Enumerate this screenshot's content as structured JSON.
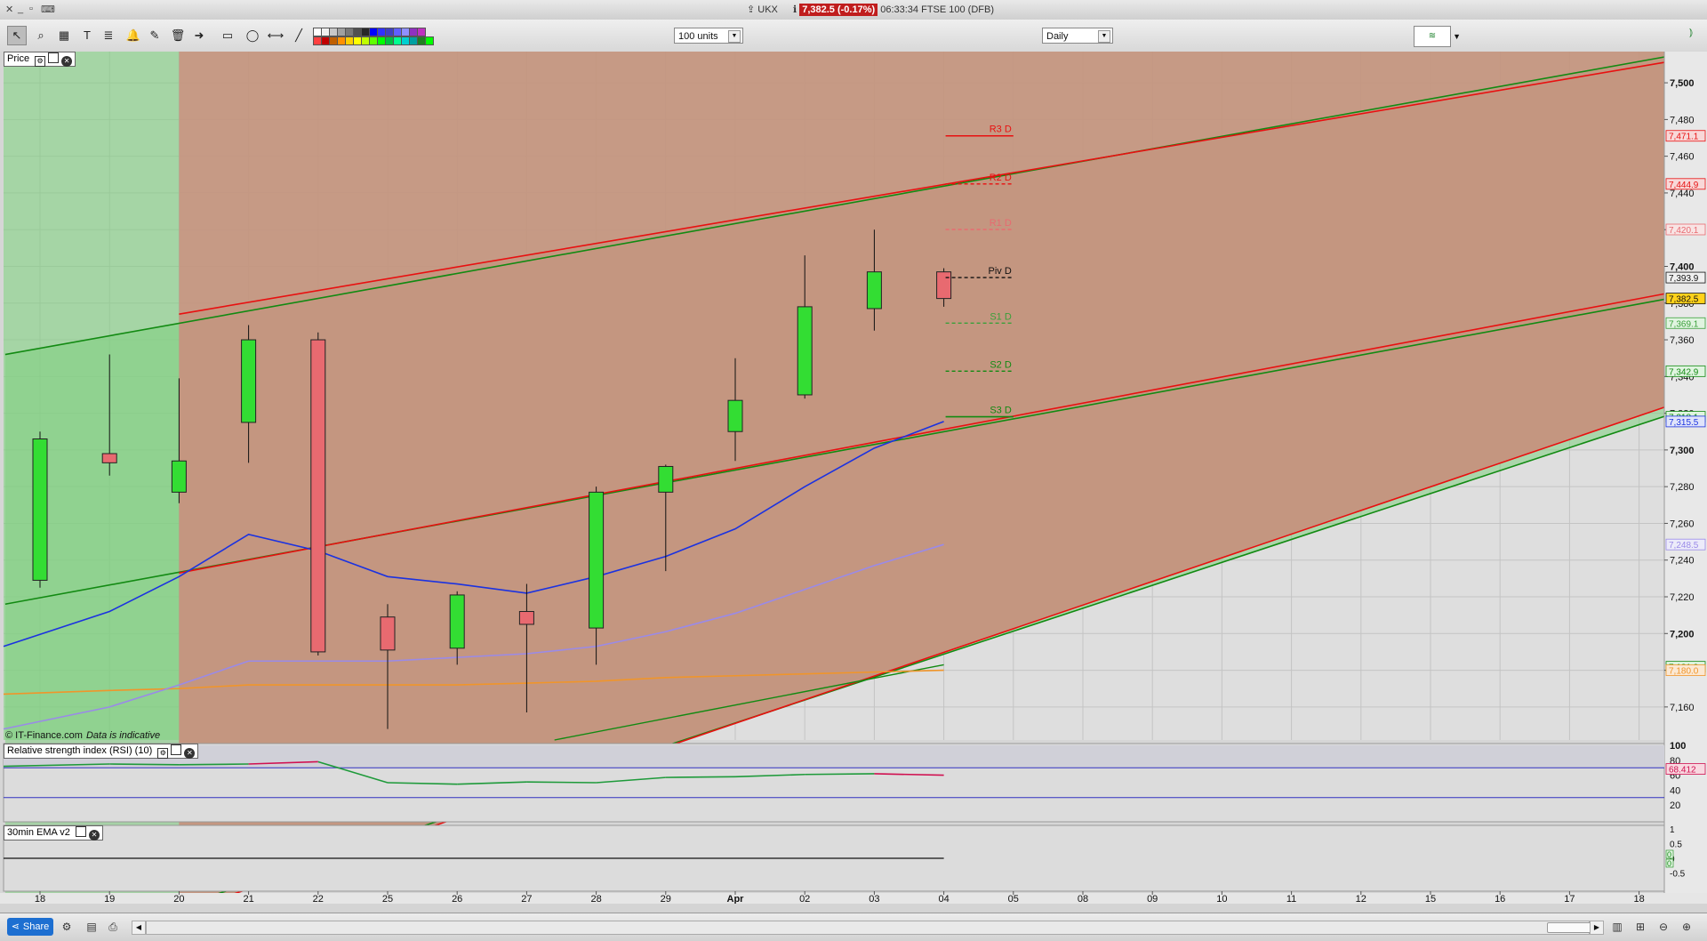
{
  "titlebar": {
    "symbol": "UKX",
    "price_badge": "7,382.5 (-0.17%)",
    "time_desc": "06:33:34 FTSE 100 (DFB)"
  },
  "toolbar": {
    "units_select": "100 units",
    "period_select": "Daily",
    "swatch_colors_row1": [
      "#ffffff",
      "#f0f0f0",
      "#c8c8c8",
      "#a0a0a0",
      "#787878",
      "#505050",
      "#282828",
      "#0000ff",
      "#3030ff",
      "#4040c0",
      "#6060ff",
      "#9090ff",
      "#9030c0",
      "#c030c0"
    ],
    "swatch_colors_row2": [
      "#ff4040",
      "#c00000",
      "#c06000",
      "#ff9000",
      "#ffd000",
      "#ffff00",
      "#c0ff00",
      "#60ff00",
      "#00ff00",
      "#00c040",
      "#00ff90",
      "#00d0d0",
      "#00a0a0",
      "#208020",
      "#00ff00"
    ]
  },
  "panels": {
    "price_label": "Price",
    "rsi_label": "Relative strength index (RSI) (10)",
    "ema_label": "30min EMA v2"
  },
  "copyright": {
    "brand": "© IT-Finance.com",
    "note": "Data is indicative"
  },
  "bottombar": {
    "share_label": "Share"
  },
  "colors": {
    "up": "#33dd33",
    "down": "#e86a70",
    "channel_fill": "#c4967f",
    "green_band": "#7fcf7f",
    "red_line": "#e81010",
    "green_line": "#128a12",
    "ma_blue": "#1b32e0",
    "ma_lavender": "#9a8ae8",
    "ma_orange": "#f0952a"
  },
  "chart_data": {
    "type": "candlestick",
    "y_axis_labels": [
      "7,500",
      "7,480",
      "7,460",
      "7,440",
      "7,420",
      "7,400",
      "7,380",
      "7,360",
      "7,340",
      "7,320",
      "7,300",
      "7,280",
      "7,260",
      "7,240",
      "7,220",
      "7,200",
      "7,180",
      "7,160"
    ],
    "ylim": [
      7142,
      7517
    ],
    "x_labels": [
      "18",
      "19",
      "20",
      "21",
      "22",
      "25",
      "26",
      "27",
      "28",
      "29",
      "Apr",
      "02",
      "03",
      "04",
      "05",
      "08",
      "09",
      "10",
      "11",
      "12",
      "15",
      "16",
      "17",
      "18"
    ],
    "candles": [
      {
        "x": "18",
        "open": 7229,
        "high": 7310,
        "low": 7225,
        "close": 7306
      },
      {
        "x": "19",
        "open": 7298,
        "high": 7352,
        "low": 7286,
        "close": 7293
      },
      {
        "x": "20",
        "open": 7277,
        "high": 7339,
        "low": 7271,
        "close": 7294
      },
      {
        "x": "21",
        "open": 7315,
        "high": 7368,
        "low": 7293,
        "close": 7360
      },
      {
        "x": "22",
        "open": 7360,
        "high": 7364,
        "low": 7188,
        "close": 7190
      },
      {
        "x": "25",
        "open": 7209,
        "high": 7216,
        "low": 7148,
        "close": 7191
      },
      {
        "x": "26",
        "open": 7192,
        "high": 7223,
        "low": 7183,
        "close": 7221
      },
      {
        "x": "27",
        "open": 7212,
        "high": 7227,
        "low": 7157,
        "close": 7205
      },
      {
        "x": "28",
        "open": 7203,
        "high": 7280,
        "low": 7183,
        "close": 7277
      },
      {
        "x": "29",
        "open": 7277,
        "high": 7292,
        "low": 7234,
        "close": 7291
      },
      {
        "x": "Apr",
        "open": 7310,
        "high": 7350,
        "low": 7294,
        "close": 7327
      },
      {
        "x": "02",
        "open": 7330,
        "high": 7406,
        "low": 7328,
        "close": 7378
      },
      {
        "x": "03",
        "open": 7377,
        "high": 7420,
        "low": 7365,
        "close": 7397
      },
      {
        "x": "04",
        "open": 7397,
        "high": 7399,
        "low": 7378,
        "close": 7382.5
      }
    ],
    "pivots": [
      {
        "label": "R3 D",
        "value": 7471.1,
        "color": "#e81010",
        "dash": false
      },
      {
        "label": "R2 D",
        "value": 7444.9,
        "color": "#e81010",
        "dash": true
      },
      {
        "label": "R1 D",
        "value": 7420.1,
        "color": "#e86a70",
        "dash": true
      },
      {
        "label": "Piv D",
        "value": 7393.9,
        "color": "#111111",
        "dash": true
      },
      {
        "label": "S1 D",
        "value": 7369.1,
        "color": "#3aa03a",
        "dash": true
      },
      {
        "label": "S2 D",
        "value": 7342.9,
        "color": "#128a12",
        "dash": true
      },
      {
        "label": "S3 D",
        "value": 7318.1,
        "color": "#128a12",
        "dash": false
      }
    ],
    "right_badges": [
      {
        "text": "7,471.1",
        "value": 7471.1,
        "color": "#e81010",
        "bg": "#f8d8d8"
      },
      {
        "text": "7,444.9",
        "value": 7444.9,
        "color": "#e81010",
        "bg": "#f8d8d8"
      },
      {
        "text": "7,420.1",
        "value": 7420.1,
        "color": "#e86a70",
        "bg": "#f8e4e4"
      },
      {
        "text": "7,393.9",
        "value": 7393.9,
        "color": "#111111",
        "bg": "#f0f0f0"
      },
      {
        "text": "7,382.5",
        "value": 7382.5,
        "color": "#111111",
        "bg": "#ffd21a"
      },
      {
        "text": "7,369.1",
        "value": 7369.1,
        "color": "#3aa03a",
        "bg": "#e0f4e0"
      },
      {
        "text": "7,342.9",
        "value": 7342.9,
        "color": "#128a12",
        "bg": "#e0f4e0"
      },
      {
        "text": "7,318.1",
        "value": 7318.1,
        "color": "#128a12",
        "bg": "#e0f4e0"
      },
      {
        "text": "7,315.5",
        "value": 7315.5,
        "color": "#1b32e0",
        "bg": "#e0e4fa"
      },
      {
        "text": "7,248.5",
        "value": 7248.5,
        "color": "#9a8ae8",
        "bg": "#ecebfa"
      },
      {
        "text": "7,181.9",
        "value": 7181.9,
        "color": "#128a12",
        "bg": "#e0f4e0"
      },
      {
        "text": "7,180.0",
        "value": 7180.0,
        "color": "#f0952a",
        "bg": "#fbe8d3"
      }
    ],
    "ma_blue": [
      7193,
      7212,
      7231,
      7254,
      7245,
      7231,
      7227,
      7222,
      7231,
      7242,
      7257,
      7280,
      7301,
      7315.5
    ],
    "ma_lavender": [
      7148,
      7160,
      7172,
      7185,
      7185,
      7185,
      7187,
      7189,
      7193,
      7201,
      7211,
      7224,
      7237,
      7248.5
    ],
    "ma_orange": [
      7167,
      7169,
      7170,
      7172,
      7172,
      7172,
      7172,
      7173,
      7174,
      7176,
      7177,
      7178,
      7179,
      7180.0
    ],
    "rsi": {
      "y_axis_labels": [
        "100",
        "80",
        "60",
        "40",
        "20"
      ],
      "ylim": [
        0,
        100
      ],
      "levels": [
        70,
        30
      ],
      "values": [
        72,
        75,
        74,
        75,
        78,
        50,
        48,
        51,
        50,
        57,
        58,
        61,
        62,
        60
      ],
      "value_badge": "68.412"
    },
    "ema": {
      "y_axis_labels": [
        "1",
        "0.5",
        "0",
        "-0.5"
      ],
      "ylim": [
        -1,
        1
      ],
      "badge_a": "0",
      "badge_b": "0"
    }
  }
}
